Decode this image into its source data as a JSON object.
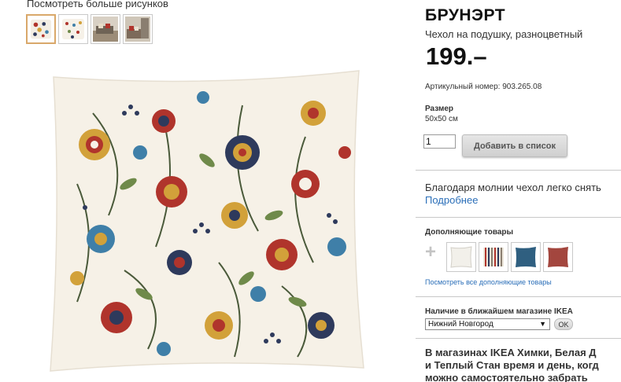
{
  "gallery": {
    "title": "Посмотреть больше рисунков",
    "thumbnails": [
      "pillow-floral",
      "pillow-floral-back",
      "room-interior-1",
      "room-interior-2"
    ]
  },
  "product": {
    "name": "БРУНЭРТ",
    "description": "Чехол на подушку, разноцветный",
    "price": "199.–",
    "article": "Артикульный номер: 903.265.08",
    "size_label": "Размер",
    "size_value": "50x50 см"
  },
  "cart": {
    "quantity": "1",
    "add_label": "Добавить в список"
  },
  "feature": {
    "text": "Благодаря молнии чехол легко снять",
    "more_link": "Подробнее"
  },
  "related": {
    "title": "Дополняющие товары",
    "items": [
      "white-cushion",
      "striped-cushion",
      "blue-cushion",
      "red-cushion"
    ],
    "link": "Посмотреть все дополняющие товары"
  },
  "stock": {
    "title": "Наличие в ближайшем магазине IKEA",
    "store": "Нижний Новгород",
    "ok_label": "OK"
  },
  "promo": {
    "lines": [
      "В магазинах IKEA Химки, Белая Д",
      "и Теплый Стан время и день, когд",
      "можно самостоятельно забрать"
    ]
  },
  "colors": {
    "link": "#2a6eb8",
    "accent_border": "#d9a86a",
    "floral_red": "#b0342c",
    "floral_navy": "#2e3a5c",
    "floral_ochre": "#d2a13a",
    "floral_blue": "#3f7fa8",
    "floral_green": "#6f8a4a"
  }
}
